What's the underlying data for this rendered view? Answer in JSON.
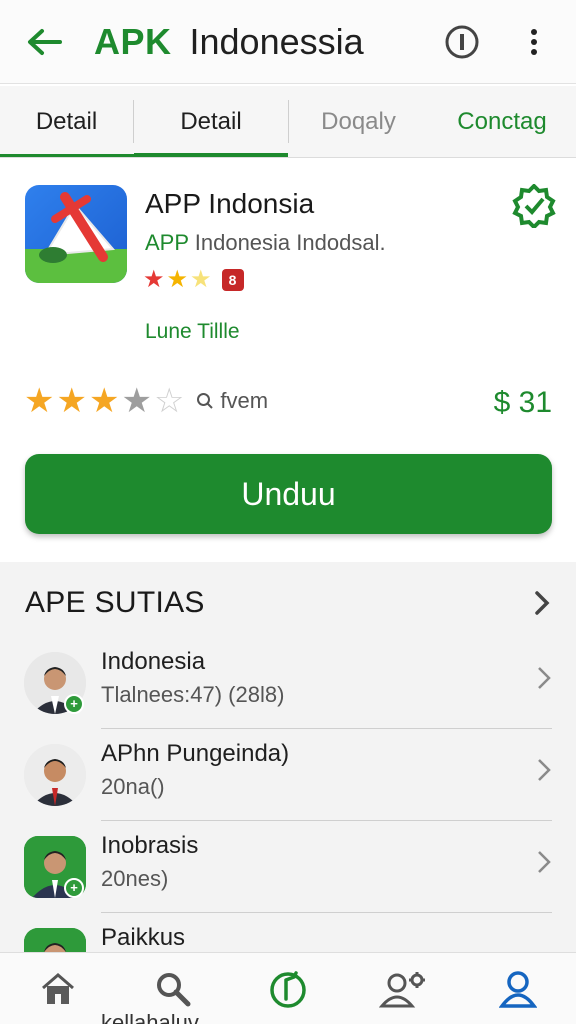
{
  "header": {
    "brand": "APK",
    "title_rest": "Indonessia"
  },
  "tabs": [
    {
      "label": "Detail"
    },
    {
      "label": "Detail"
    },
    {
      "label": "Doqaly"
    },
    {
      "label": "Conctag"
    }
  ],
  "app": {
    "name": "APP Indonsia",
    "subtitle_green": "APP",
    "subtitle_rest": "Indonesia Indodsal.",
    "age_badge": "8",
    "link": "Lune Tillle",
    "rating": 3.5,
    "review_label": "fvem",
    "price": "$ 31",
    "download_label": "Unduu"
  },
  "section": {
    "title": "APE SUTIAS",
    "items": [
      {
        "title": "Indonesia",
        "subtitle": "Tlalnees:47) (28l8)"
      },
      {
        "title": "APhn Pungeinda)",
        "subtitle": "20na()"
      },
      {
        "title": "Inobrasis",
        "subtitle": "20nes)"
      },
      {
        "title": "Paikkus",
        "subtitle": ""
      }
    ],
    "peek_text": "kellahaluv"
  },
  "colors": {
    "accent": "#1e8a2e",
    "active_nav": "#1565c0",
    "star": "#f5a623"
  },
  "bottom_nav": [
    {
      "icon": "home-icon"
    },
    {
      "icon": "search-icon"
    },
    {
      "icon": "rocket-update-icon"
    },
    {
      "icon": "user-settings-icon"
    },
    {
      "icon": "profile-icon"
    }
  ]
}
